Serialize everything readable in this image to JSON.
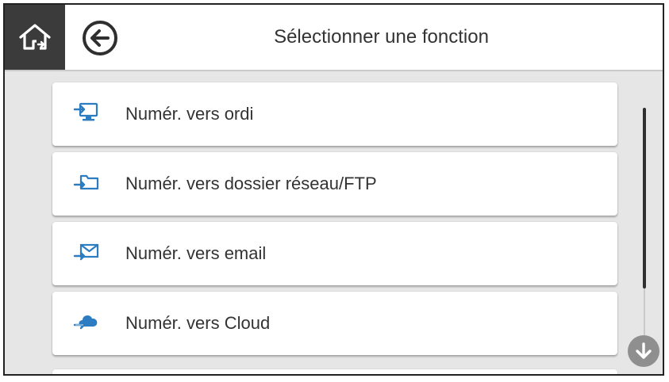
{
  "header": {
    "title": "Sélectionner une fonction",
    "home_icon": "home-icon",
    "back_icon": "back-arrow-icon"
  },
  "menu": {
    "items": [
      {
        "label": "Numér. vers ordi",
        "icon": "computer-icon"
      },
      {
        "label": "Numér. vers dossier réseau/FTP",
        "icon": "network-folder-icon"
      },
      {
        "label": "Numér. vers email",
        "icon": "email-icon"
      },
      {
        "label": "Numér. vers Cloud",
        "icon": "cloud-icon"
      }
    ]
  },
  "scrollbar": {
    "down_icon": "scroll-down-icon"
  },
  "colors": {
    "accent_blue": "#2b7cc1",
    "home_bg": "#3b3b3b",
    "panel_bg": "#e6e6e6"
  }
}
